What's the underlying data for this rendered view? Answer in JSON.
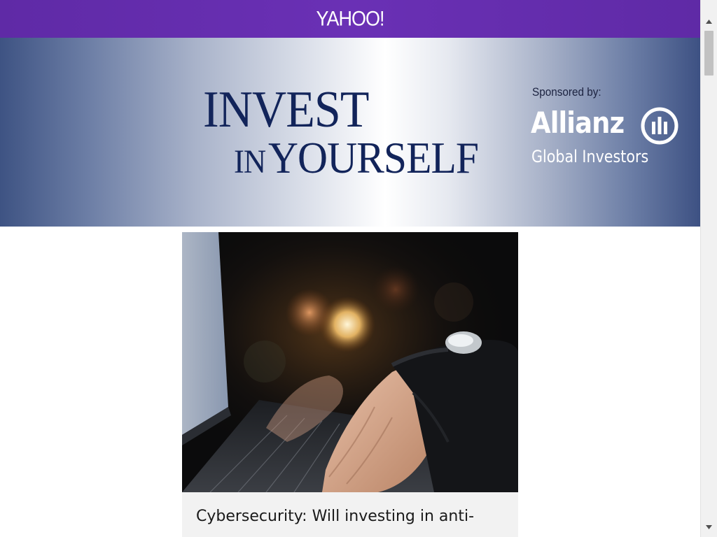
{
  "header": {
    "logo_text": "YAHOO!",
    "background_color": "#6a30b5"
  },
  "banner": {
    "headline_line1": "INVEST",
    "headline_line2_prefix": "IN",
    "headline_line2_main": "YOURSELF",
    "sponsor_label": "Sponsored by:",
    "sponsor_name": "Allianz",
    "sponsor_subname": "Global Investors",
    "headline_color": "#12245a",
    "sponsor_logo_icon": "allianz-eagle-icon"
  },
  "article": {
    "image_description_icon": "hands-typing-laptop-photo",
    "title": "Cybersecurity: Will investing in anti-"
  },
  "scrollbar": {
    "up_icon": "arrow-up-icon",
    "down_icon": "arrow-down-icon"
  }
}
